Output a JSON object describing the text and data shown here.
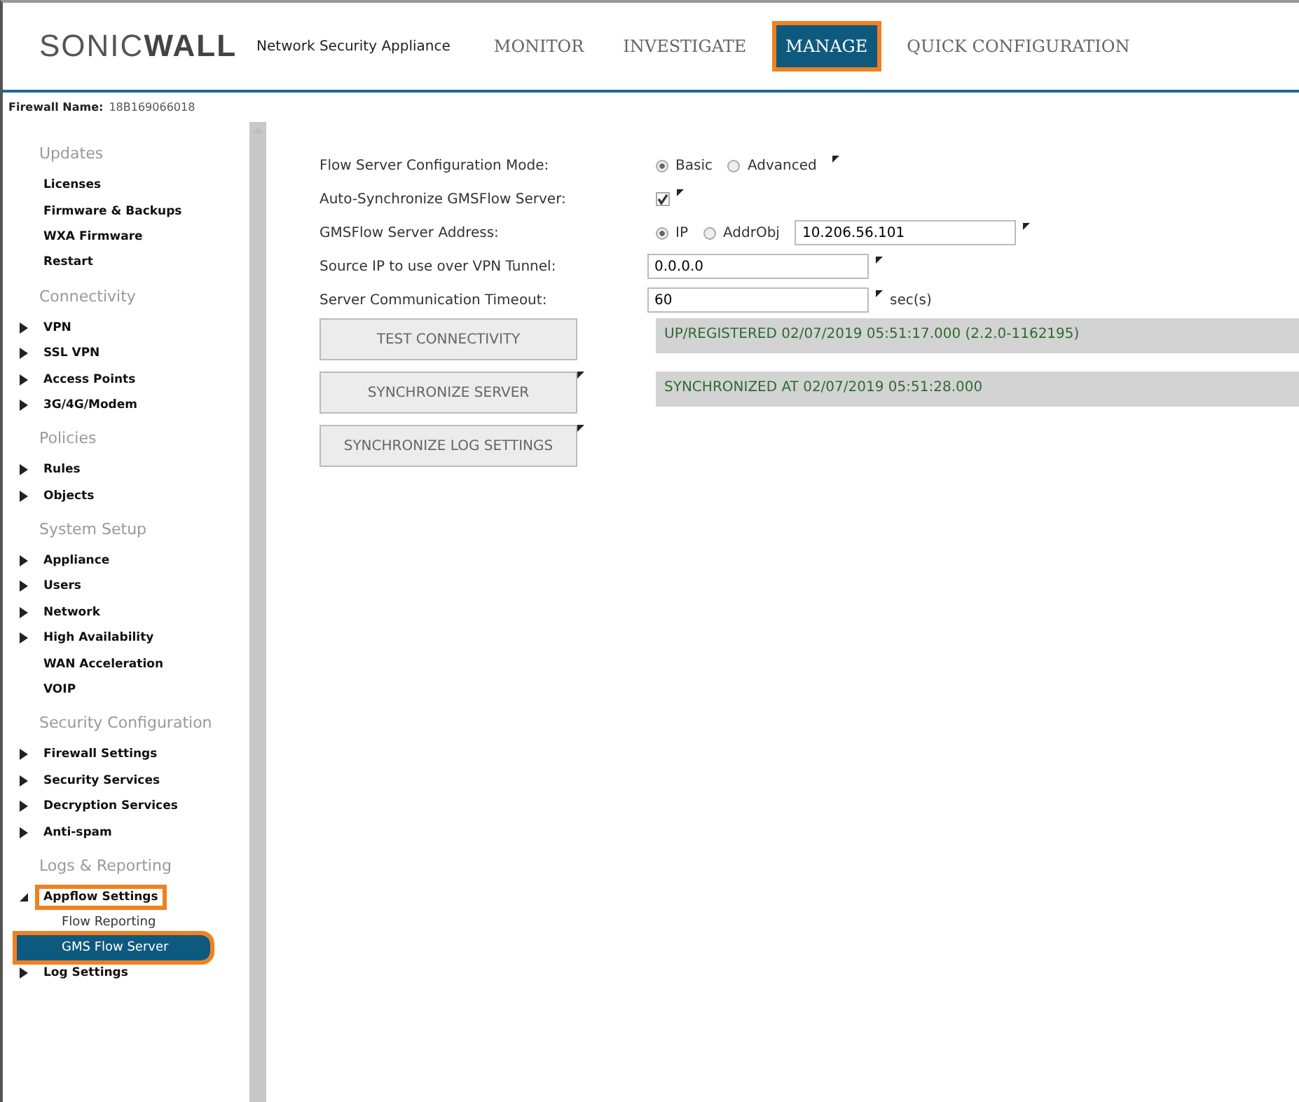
{
  "header": {
    "logo_light": "SONIC",
    "logo_bold": "WALL",
    "product": "Network Security Appliance",
    "tabs": [
      {
        "label": "MONITOR",
        "selected": false,
        "highlighted": false
      },
      {
        "label": "INVESTIGATE",
        "selected": false,
        "highlighted": false
      },
      {
        "label": "MANAGE",
        "selected": true,
        "highlighted": true
      },
      {
        "label": "QUICK CONFIGURATION",
        "selected": false,
        "highlighted": false
      }
    ]
  },
  "firewall": {
    "label": "Firewall Name:",
    "value": "18B169066018"
  },
  "sidebar": {
    "sections": [
      {
        "heading": "Updates",
        "items": [
          {
            "label": "Licenses",
            "kind": "leaf",
            "selected": false,
            "highlighted": false
          },
          {
            "label": "Firmware & Backups",
            "kind": "leaf",
            "selected": false,
            "highlighted": false
          },
          {
            "label": "WXA Firmware",
            "kind": "leaf",
            "selected": false,
            "highlighted": false
          },
          {
            "label": "Restart",
            "kind": "leaf",
            "selected": false,
            "highlighted": false
          }
        ]
      },
      {
        "heading": "Connectivity",
        "items": [
          {
            "label": "VPN",
            "kind": "collapsed",
            "selected": false,
            "highlighted": false
          },
          {
            "label": "SSL VPN",
            "kind": "collapsed",
            "selected": false,
            "highlighted": false
          },
          {
            "label": "Access Points",
            "kind": "collapsed",
            "selected": false,
            "highlighted": false
          },
          {
            "label": "3G/4G/Modem",
            "kind": "collapsed",
            "selected": false,
            "highlighted": false
          }
        ]
      },
      {
        "heading": "Policies",
        "items": [
          {
            "label": "Rules",
            "kind": "collapsed",
            "selected": false,
            "highlighted": false
          },
          {
            "label": "Objects",
            "kind": "collapsed",
            "selected": false,
            "highlighted": false
          }
        ]
      },
      {
        "heading": "System Setup",
        "items": [
          {
            "label": "Appliance",
            "kind": "collapsed",
            "selected": false,
            "highlighted": false
          },
          {
            "label": "Users",
            "kind": "collapsed",
            "selected": false,
            "highlighted": false
          },
          {
            "label": "Network",
            "kind": "collapsed",
            "selected": false,
            "highlighted": false
          },
          {
            "label": "High Availability",
            "kind": "collapsed",
            "selected": false,
            "highlighted": false
          },
          {
            "label": "WAN Acceleration",
            "kind": "leaf",
            "selected": false,
            "highlighted": false
          },
          {
            "label": "VOIP",
            "kind": "leaf",
            "selected": false,
            "highlighted": false
          }
        ]
      },
      {
        "heading": "Security Configuration",
        "items": [
          {
            "label": "Firewall Settings",
            "kind": "collapsed",
            "selected": false,
            "highlighted": false
          },
          {
            "label": "Security Services",
            "kind": "collapsed",
            "selected": false,
            "highlighted": false
          },
          {
            "label": "Decryption Services",
            "kind": "collapsed",
            "selected": false,
            "highlighted": false
          },
          {
            "label": "Anti-spam",
            "kind": "collapsed",
            "selected": false,
            "highlighted": false
          }
        ]
      },
      {
        "heading": "Logs & Reporting",
        "items": [
          {
            "label": "Appflow Settings",
            "kind": "expanded",
            "selected": false,
            "highlighted": true,
            "children": [
              {
                "label": "Flow Reporting",
                "selected": false,
                "highlighted": false
              },
              {
                "label": "GMS Flow Server",
                "selected": true,
                "highlighted": true
              }
            ]
          },
          {
            "label": "Log Settings",
            "kind": "collapsed",
            "selected": false,
            "highlighted": false
          }
        ]
      }
    ]
  },
  "form": {
    "mode": {
      "label": "Flow Server Configuration Mode:",
      "options": [
        {
          "label": "Basic",
          "selected": true
        },
        {
          "label": "Advanced",
          "selected": false
        }
      ]
    },
    "auto_sync": {
      "label": "Auto-Synchronize GMSFlow Server:",
      "checked": true
    },
    "address": {
      "label": "GMSFlow Server Address:",
      "options": [
        {
          "label": "IP",
          "selected": true
        },
        {
          "label": "AddrObj",
          "selected": false
        }
      ],
      "value": "10.206.56.101"
    },
    "source_ip": {
      "label": "Source IP to use over VPN Tunnel:",
      "value": "0.0.0.0"
    },
    "timeout": {
      "label": "Server Communication Timeout:",
      "value": "60",
      "unit": "sec(s)"
    },
    "actions": [
      {
        "label": "TEST CONNECTIVITY",
        "status": "UP/REGISTERED 02/07/2019 05:51:17.000 (2.2.0-1162195)",
        "marker": false
      },
      {
        "label": "SYNCHRONIZE SERVER",
        "status": "SYNCHRONIZED AT 02/07/2019 05:51:28.000",
        "marker": true
      },
      {
        "label": "SYNCHRONIZE LOG SETTINGS",
        "marker": true
      }
    ]
  }
}
